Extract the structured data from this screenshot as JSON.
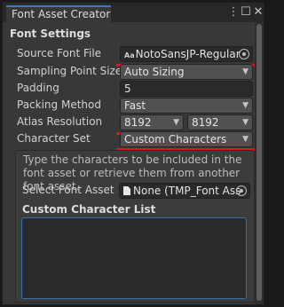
{
  "window": {
    "tab_title": "Font Asset Creator",
    "menu_icon": "kebab-menu-icon",
    "maximize_icon": "maximize-icon",
    "close_icon": "close-icon"
  },
  "font_settings": {
    "title": "Font Settings",
    "source_font_file": {
      "label": "Source Font File",
      "value": "NotoSansJP-Regular",
      "icon": "Aa"
    },
    "sampling_point_size": {
      "label": "Sampling Point Size",
      "value": "Auto Sizing"
    },
    "padding": {
      "label": "Padding",
      "value": "5"
    },
    "packing_method": {
      "label": "Packing Method",
      "value": "Fast"
    },
    "atlas_resolution": {
      "label": "Atlas Resolution",
      "width": "8192",
      "height": "8192"
    },
    "character_set": {
      "label": "Character Set",
      "value": "Custom Characters"
    },
    "help_text": "Type the characters to be included in the font asset or retrieve them from another font asset.",
    "select_font_asset": {
      "label": "Select Font Asset",
      "value": "None (TMP_Font Ass"
    },
    "custom_character_list": {
      "title": "Custom Character List",
      "value": ""
    }
  },
  "annotation_color": "#e0161e"
}
